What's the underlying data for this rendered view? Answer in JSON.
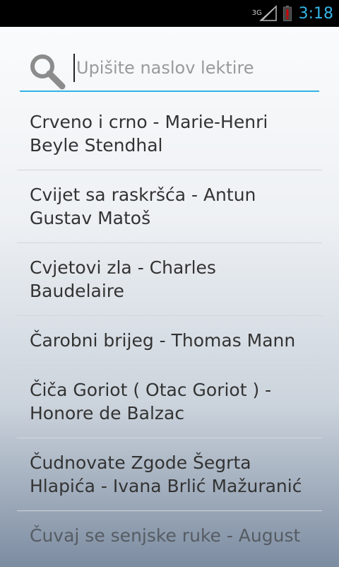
{
  "status_bar": {
    "network_type": "3G",
    "time": "3:18",
    "colors": {
      "clock": "#33b5e5",
      "battery_alert": "#cc0000"
    },
    "icons": [
      "signal-icon",
      "battery-alert-icon"
    ]
  },
  "search": {
    "placeholder": "Upišite naslov lektire",
    "value": ""
  },
  "books": [
    {
      "title": "Crveno i crno - Marie-Henri Beyle Stendhal"
    },
    {
      "title": "Cvijet sa raskršća - Antun Gustav Matoš"
    },
    {
      "title": "Cvjetovi zla - Charles Baudelaire"
    },
    {
      "title": "Čarobni brijeg - Thomas Mann"
    },
    {
      "title": "Čiča Goriot ( Otac Goriot ) - Honore de Balzac"
    },
    {
      "title": "Čudnovate Zgode Šegrta Hlapića - Ivana Brlić Mažuranić"
    },
    {
      "title": "Čuvaj se senjske ruke - August"
    }
  ],
  "colors": {
    "accent": "#33b5e5"
  }
}
